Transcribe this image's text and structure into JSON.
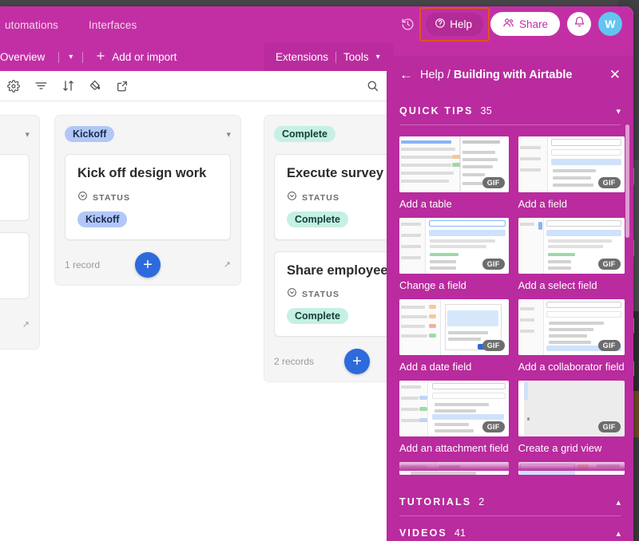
{
  "window": {
    "header_color": "#c22fa5",
    "panel_color": "#b92b9e",
    "highlight_color": "#e0531f",
    "accent_blue": "#2d6adb"
  },
  "topnav": {
    "items": [
      {
        "label": "utomations",
        "name": "nav-automations"
      },
      {
        "label": "Interfaces",
        "name": "nav-interfaces"
      }
    ],
    "history_icon": "history-clock-icon",
    "help_label": "Help",
    "help_icon": "question-circle-icon",
    "share_label": "Share",
    "share_icon": "people-icon",
    "bell_icon": "bell-icon",
    "avatar_initial": "W"
  },
  "tabbar": {
    "view_label": "Overview",
    "chevron_icon": "chevron-down-icon",
    "add_icon": "plus-icon",
    "add_label": "Add or import",
    "extensions_label": "Extensions",
    "tools_label": "Tools",
    "tools_chevron_icon": "chevron-down-icon"
  },
  "toolbar": {
    "icons": [
      {
        "name": "view-settings-gear-icon",
        "glyph": "gear"
      },
      {
        "name": "filter-icon",
        "glyph": "filter"
      },
      {
        "name": "sort-icon",
        "glyph": "sort"
      },
      {
        "name": "color-icon",
        "glyph": "paint"
      },
      {
        "name": "share-view-icon",
        "glyph": "external"
      }
    ],
    "search_icon": "search-icon"
  },
  "board": {
    "columns": [
      {
        "name": "column-partial-left",
        "stack_label": "",
        "chip_class": "",
        "cards": [],
        "records_label": "",
        "partial": true
      },
      {
        "name": "column-kickoff",
        "stack_label": "Kickoff",
        "chip_class": "chip-kickoff",
        "collapse_icon": "chevron-down-icon",
        "cards": [
          {
            "title": "Kick off design work",
            "field_label": "STATUS",
            "field_icon": "single-select-icon",
            "value": "Kickoff",
            "value_class": "chip-kickoff"
          }
        ],
        "records_label": "1 record",
        "add_icon": "plus-icon",
        "expand_icon": "expand-icon"
      },
      {
        "name": "column-complete",
        "stack_label": "Complete",
        "chip_class": "chip-complete",
        "collapse_icon": "chevron-down-icon",
        "cards": [
          {
            "title": "Execute survey",
            "field_label": "STATUS",
            "field_icon": "single-select-icon",
            "value": "Complete",
            "value_class": "chip-complete"
          },
          {
            "title": "Share employee sur",
            "field_label": "STATUS",
            "field_icon": "single-select-icon",
            "value": "Complete",
            "value_class": "chip-complete"
          }
        ],
        "records_label": "2 records",
        "add_icon": "plus-icon"
      }
    ]
  },
  "help_panel": {
    "back_icon": "arrow-left-icon",
    "breadcrumb_root": "Help",
    "breadcrumb_sep": " / ",
    "breadcrumb_current": "Building with Airtable",
    "close_icon": "close-x-icon",
    "sections": [
      {
        "name": "quick-tips",
        "title": "QUICK TIPS",
        "count": "35",
        "chevron_icon": "chevron-down-icon",
        "expanded": true
      },
      {
        "name": "tutorials",
        "title": "TUTORIALS",
        "count": "2",
        "chevron_icon": "chevron-up-icon",
        "expanded": false
      },
      {
        "name": "videos",
        "title": "VIDEOS",
        "count": "41",
        "chevron_icon": "chevron-up-icon",
        "expanded": false
      }
    ],
    "tips": [
      {
        "label": "Add a table",
        "badge": "GIF",
        "variant": "grid-menu"
      },
      {
        "label": "Add a field",
        "badge": "GIF",
        "variant": "field-list"
      },
      {
        "label": "Change a field",
        "badge": "GIF",
        "variant": "field-config"
      },
      {
        "label": "Add a select field",
        "badge": "GIF",
        "variant": "field-config"
      },
      {
        "label": "Add a date field",
        "badge": "GIF",
        "variant": "dialog"
      },
      {
        "label": "Add a collaborator field",
        "badge": "GIF",
        "variant": "field-list"
      },
      {
        "label": "Add an attachment field",
        "badge": "GIF",
        "variant": "field-list"
      },
      {
        "label": "Create a grid view",
        "badge": "GIF",
        "variant": "blank"
      }
    ]
  }
}
